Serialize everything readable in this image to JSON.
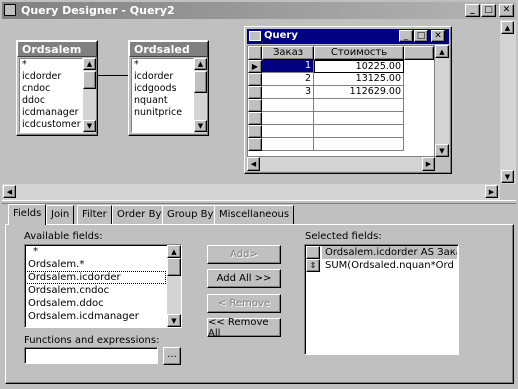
{
  "window": {
    "title": "Query Designer - Query2",
    "min_label": "_",
    "max_label": "□",
    "close_label": "✕"
  },
  "tables": [
    {
      "name": "Ordsalem",
      "fields": [
        "*",
        "icdorder",
        "cndoc",
        "ddoc",
        "icdmanager",
        "icdcustomer"
      ]
    },
    {
      "name": "Ordsaled",
      "fields": [
        "*",
        "icdorder",
        "icdgoods",
        "nquant",
        "nunitprice"
      ]
    }
  ],
  "query_window": {
    "title": "Query",
    "columns": [
      "Заказ",
      "Стоимость"
    ],
    "rows": [
      {
        "order": "1",
        "cost": "10225.00"
      },
      {
        "order": "2",
        "cost": "13125.00"
      },
      {
        "order": "3",
        "cost": "112629.00"
      }
    ]
  },
  "tabs": [
    "Fields",
    "Join",
    "Filter",
    "Order By",
    "Group By",
    "Miscellaneous"
  ],
  "available": {
    "label": "Available fields:",
    "items": [
      "*",
      "Ordsalem.*",
      "Ordsalem.icdorder",
      "Ordsalem.cndoc",
      "Ordsalem.ddoc",
      "Ordsalem.icdmanager"
    ]
  },
  "buttons": {
    "add": "Add>",
    "add_all": "Add All >>",
    "remove": "< Remove",
    "remove_all": "<< Remove All",
    "ellipsis": "..."
  },
  "selected": {
    "label": "Selected fields:",
    "items": [
      "Ordsalem.icdorder AS Заказ",
      "SUM(Ordsaled.nquan*Ord"
    ]
  },
  "functions": {
    "label": "Functions and expressions:",
    "value": ""
  }
}
